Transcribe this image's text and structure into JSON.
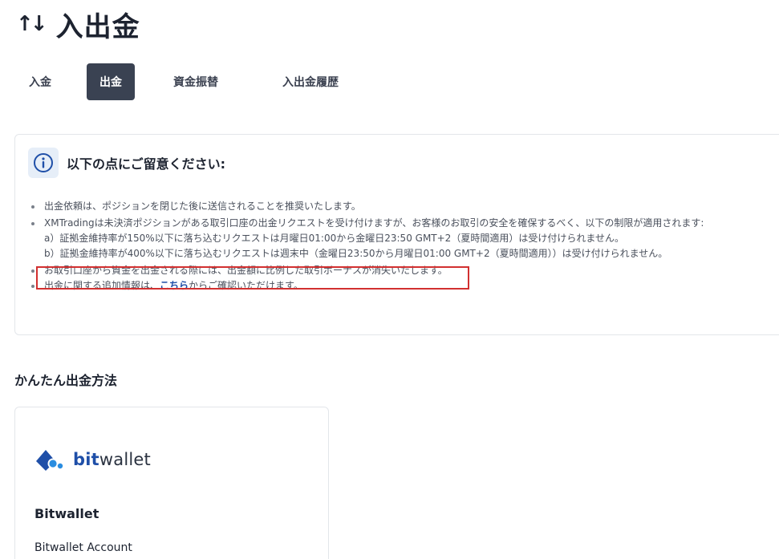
{
  "header": {
    "title": "入出金"
  },
  "tabs": [
    {
      "label": "入金"
    },
    {
      "label": "出金"
    },
    {
      "label": "資金振替"
    },
    {
      "label": "入出金履歴"
    }
  ],
  "active_tab": "出金",
  "notice": {
    "title": "以下の点にご留意ください:",
    "items": {
      "item1": "出金依頼は、ポジションを閉じた後に送信されることを推奨いたします。",
      "item2_main": "XMTradingは未決済ポジションがある取引口座の出金リクエストを受け付けますが、お客様のお取引の安全を確保するべく、以下の制限が適用されます:",
      "item2_a": "a）証拠金維持率が150%以下に落ち込むリクエストは月曜日01:00から金曜日23:50 GMT+2（夏時間適用）は受け付けられません。",
      "item2_b": "b）証拠金維持率が400%以下に落ち込むリクエストは週末中（金曜日23:50から月曜日01:00 GMT+2（夏時間適用））は受け付けられません。",
      "item3": "お取引口座から資金を出金される際には、出金額に比例した取引ボーナスが消失いたします。",
      "item4_before": "出金に関する追加情報は、",
      "item4_link": "こちら",
      "item4_after": "からご確認いただけます。"
    }
  },
  "section": {
    "title": "かんたん出金方法"
  },
  "method": {
    "logo_text_bold": "bit",
    "logo_text_rest": "wallet",
    "name": "Bitwallet",
    "subtitle": "Bitwallet Account"
  },
  "colors": {
    "active_tab_bg": "#3a4252",
    "link": "#1f4fa8",
    "highlight_border": "#d23030",
    "info_icon": "#1f4fa8"
  }
}
